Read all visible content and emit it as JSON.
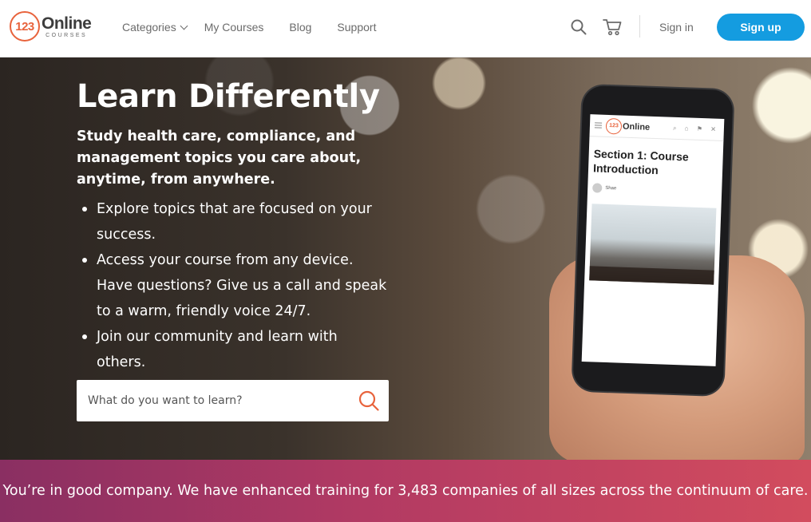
{
  "header": {
    "logo": {
      "number": "123",
      "main": "Online",
      "sub": "COURSES"
    },
    "nav": [
      {
        "label": "Categories"
      },
      {
        "label": "My Courses"
      },
      {
        "label": "Blog"
      },
      {
        "label": "Support"
      }
    ],
    "signin_label": "Sign in",
    "signup_label": "Sign up"
  },
  "hero": {
    "title": "Learn Differently",
    "subtitle": "Study health care, compliance, and management topics you care about, anytime, from anywhere.",
    "bullets": [
      "Explore topics that are focused on your success.",
      "Access your course from any device. Have questions? Give us a call and speak to a warm, friendly voice 24/7.",
      "Join our community and learn with others."
    ],
    "search_placeholder": "What do you want to learn?"
  },
  "phone": {
    "logo_number": "123",
    "logo_text": "Online",
    "title": "Section 1: Course Introduction",
    "author": "Shae"
  },
  "band": {
    "text": "You’re in good company. We have enhanced training for 3,483 companies of all sizes across the continuum of care."
  },
  "colors": {
    "accent": "#149ce0",
    "brand": "#e8633c",
    "band_start": "#8a2f62",
    "band_end": "#d24c5e"
  }
}
